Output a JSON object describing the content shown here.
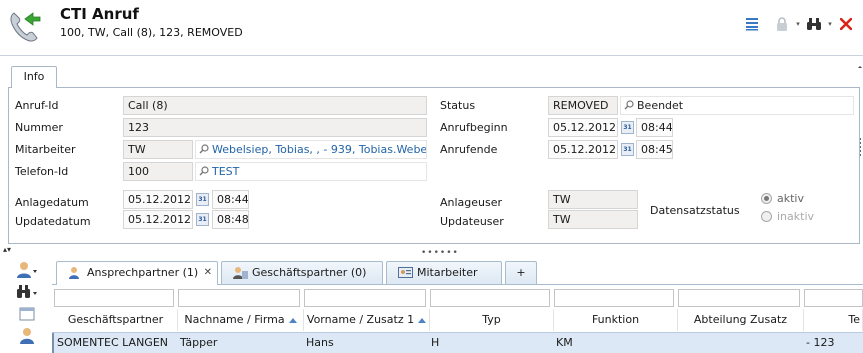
{
  "header": {
    "title": "CTI Anruf",
    "subtitle": "100, TW, Call (8), 123, REMOVED",
    "toolbar": {
      "list_icon": "list-icon",
      "lock_icon": "lock-icon",
      "search_icon": "binoculars-icon",
      "close_icon": "close-icon",
      "dropdown_glyph": "▾"
    }
  },
  "info_tab": {
    "label": "Info"
  },
  "info": {
    "anruf_id": {
      "label": "Anruf-Id",
      "value": "Call (8)"
    },
    "nummer": {
      "label": "Nummer",
      "value": "123"
    },
    "mitarbeiter": {
      "label": "Mitarbeiter",
      "value": "TW",
      "link": "Webelsiep, Tobias, , - 939, Tobias.Webel"
    },
    "telefon_id": {
      "label": "Telefon-Id",
      "value": "100",
      "link": "TEST"
    },
    "anlagedatum": {
      "label": "Anlagedatum",
      "date": "05.12.2012",
      "time": "08:44"
    },
    "updatedatum": {
      "label": "Updatedatum",
      "date": "05.12.2012",
      "time": "08:48"
    },
    "status": {
      "label": "Status",
      "value": "REMOVED",
      "link": "Beendet"
    },
    "anrufbeginn": {
      "label": "Anrufbeginn",
      "date": "05.12.2012",
      "time": "08:44"
    },
    "anrufende": {
      "label": "Anrufende",
      "date": "05.12.2012",
      "time": "08:45"
    },
    "anlageuser": {
      "label": "Anlageuser",
      "value": "TW"
    },
    "updateuser": {
      "label": "Updateuser",
      "value": "TW"
    },
    "datensatzstatus": {
      "label": "Datensatzstatus",
      "options": [
        "aktiv",
        "inaktiv"
      ],
      "selected": "aktiv"
    },
    "calendar_glyph": "31"
  },
  "splitter": {
    "dots": "••••••",
    "arrows": "▴▾"
  },
  "tabs": [
    {
      "label": "Ansprechpartner (1)",
      "close": "✕",
      "icon": "contact-person-icon"
    },
    {
      "label": "Geschäftspartner (0)",
      "icon": "business-partner-icon"
    },
    {
      "label": "Mitarbeiter",
      "icon": "employee-card-icon"
    },
    {
      "label": "+"
    }
  ],
  "grid": {
    "columns": [
      "Geschäftspartner",
      "Nachname / Firma",
      "Vorname / Zusatz 1",
      "Typ",
      "Funktion",
      "Abteilung Zusatz",
      "Te"
    ],
    "sorted_columns": [
      1,
      2
    ],
    "rows": [
      [
        "SOMENTEC LANGEN",
        "Täpper",
        "Hans",
        "H",
        "KM",
        "",
        "- 123"
      ]
    ]
  },
  "colors": {
    "accent": "#2264a8",
    "close_red": "#d9261c",
    "tab_border": "#a9bccf",
    "row_selected": "#dce8f5"
  }
}
